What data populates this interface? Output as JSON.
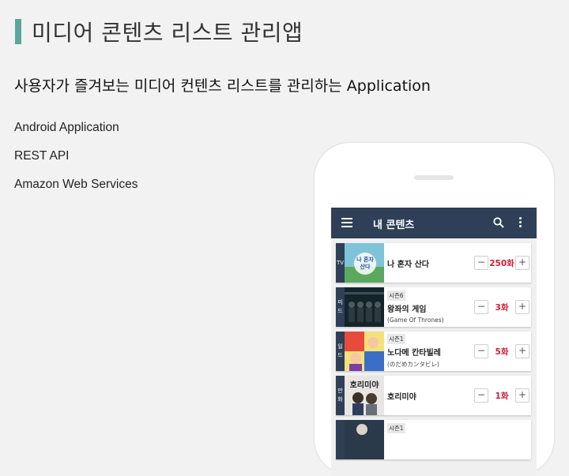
{
  "slide": {
    "title": "미디어 콘텐츠 리스트 관리앱",
    "subtitle": "사용자가 즐겨보는 미디어 컨텐츠 리스트를 관리하는 Application",
    "bullets": [
      "Android Application",
      "REST API",
      "Amazon Web Services"
    ],
    "accent_color": "#5aa79a"
  },
  "app": {
    "title": "내 콘텐츠",
    "bar_color": "#2e3f57",
    "count_color": "#c8203a",
    "icons": {
      "menu": "menu-icon",
      "search": "search-icon",
      "more": "more-vert-icon"
    },
    "minus_label": "−",
    "plus_label": "+",
    "items": [
      {
        "category": [
          "TV"
        ],
        "badge": "",
        "title": "나 혼자 산다",
        "original": "",
        "count": "250화",
        "thumb_label": "나 혼자 산다"
      },
      {
        "category": [
          "미",
          "드"
        ],
        "badge": "시즌6",
        "title": "왕좌의 게임",
        "original": "(Game Of Thrones)",
        "count": "3화",
        "thumb_label": ""
      },
      {
        "category": [
          "일",
          "드"
        ],
        "badge": "시즌1",
        "title": "노다메 칸타빌레",
        "original": "(のだめカンタビレ)",
        "count": "5화",
        "thumb_label": ""
      },
      {
        "category": [
          "만",
          "화"
        ],
        "badge": "",
        "title": "호리미야",
        "original": "",
        "count": "1화",
        "thumb_label": "호리미야"
      },
      {
        "category": [],
        "badge": "시즌1",
        "title": "",
        "original": "",
        "count": "",
        "thumb_label": ""
      }
    ]
  }
}
